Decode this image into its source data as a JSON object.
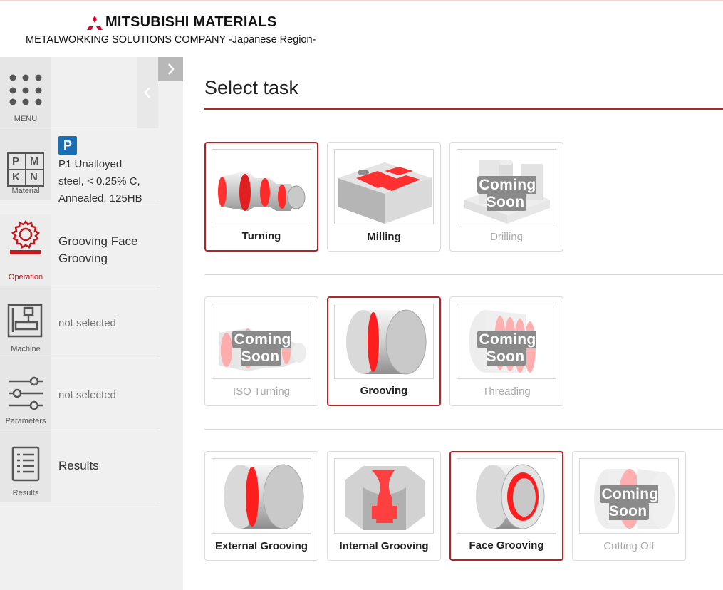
{
  "header": {
    "brand": "MITSUBISHI MATERIALS",
    "subtitle": "METALWORKING SOLUTIONS COMPANY -Japanese Region-"
  },
  "sidebar": {
    "menu_caption": "MENU",
    "rows": [
      {
        "caption": "Material",
        "badge": "P",
        "line1": "P1 Unalloyed",
        "line2": "steel, < 0.25% C,",
        "line3": "Annealed, 125HB"
      },
      {
        "caption": "Operation",
        "line1": "Grooving Face",
        "line2": "Grooving"
      },
      {
        "caption": "Machine",
        "value": "not selected"
      },
      {
        "caption": "Parameters",
        "value": "not selected"
      },
      {
        "caption": "Results",
        "value": "Results"
      }
    ],
    "material_letters": [
      "P",
      "M",
      "K",
      "N"
    ]
  },
  "main": {
    "title": "Select task",
    "coming_soon": "Coming Soon",
    "row1": [
      {
        "label": "Turning",
        "state": "selected"
      },
      {
        "label": "Milling",
        "state": "normal"
      },
      {
        "label": "Drilling",
        "state": "disabled"
      }
    ],
    "row2": [
      {
        "label": "ISO Turning",
        "state": "disabled"
      },
      {
        "label": "Grooving",
        "state": "selected"
      },
      {
        "label": "Threading",
        "state": "disabled"
      }
    ],
    "row3": [
      {
        "label": "External Grooving",
        "state": "normal"
      },
      {
        "label": "Internal Grooving",
        "state": "normal"
      },
      {
        "label": "Face Grooving",
        "state": "selected"
      },
      {
        "label": "Cutting Off",
        "state": "disabled"
      }
    ]
  },
  "colors": {
    "accent": "#b52228",
    "badge_blue": "#1a6fb4",
    "highlight_red": "#ff2a2a"
  }
}
